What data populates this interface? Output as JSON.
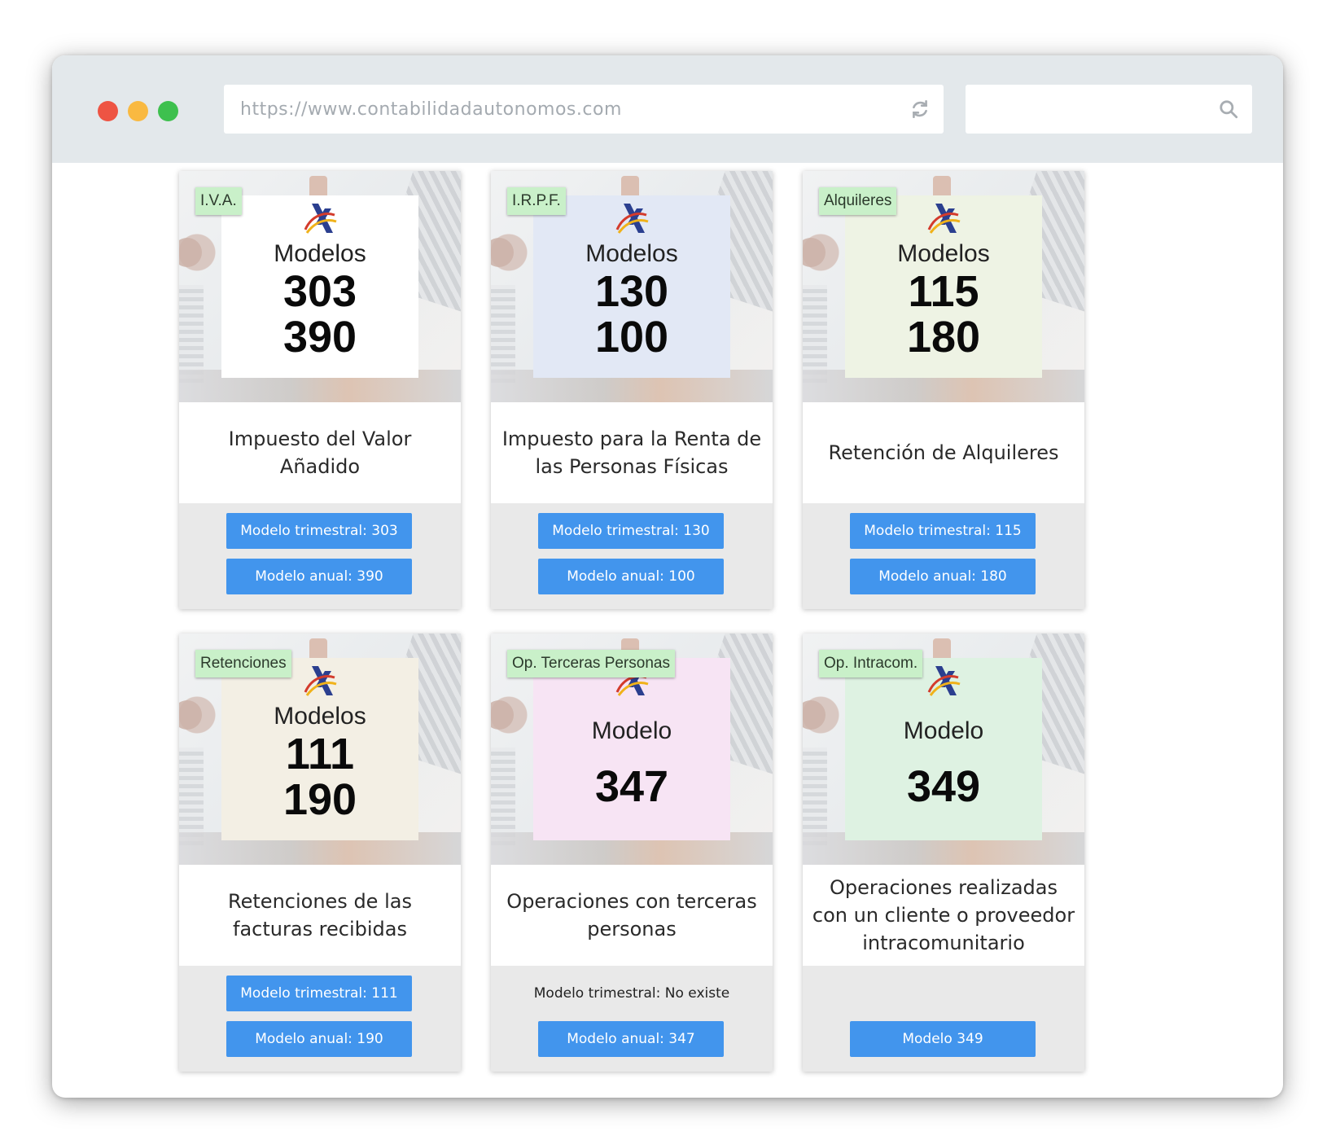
{
  "browser": {
    "url": "https://www.contabilidadautonomos.com",
    "search_value": ""
  },
  "colors": {
    "button": "#4295ed",
    "tag": "#c9f0c9",
    "poster_iva": "#ffffff",
    "poster_irpf": "#e2e8f5",
    "poster_alquileres": "#eef3e4",
    "poster_retenciones": "#f3efe4",
    "poster_terceras": "#f7e4f4",
    "poster_intracom": "#def2e2"
  },
  "cards": [
    {
      "tag": "I.V.A.",
      "poster_title": "Modelos",
      "num1": "303",
      "num2": "390",
      "description": "Impuesto del Valor Añadido",
      "btn1": "Modelo trimestral: 303",
      "btn2": "Modelo anual: 390"
    },
    {
      "tag": "I.R.P.F.",
      "poster_title": "Modelos",
      "num1": "130",
      "num2": "100",
      "description": "Impuesto para la Renta de las Personas Físicas",
      "btn1": "Modelo trimestral: 130",
      "btn2": "Modelo anual: 100"
    },
    {
      "tag": "Alquileres",
      "poster_title": "Modelos",
      "num1": "115",
      "num2": "180",
      "description": "Retención de Alquileres",
      "btn1": "Modelo trimestral: 115",
      "btn2": "Modelo anual: 180"
    },
    {
      "tag": "Retenciones",
      "poster_title": "Modelos",
      "num1": "111",
      "num2": "190",
      "description": "Retenciones de las facturas recibidas",
      "btn1": "Modelo trimestral: 111",
      "btn2": "Modelo anual: 190"
    },
    {
      "tag": "Op. Terceras Personas",
      "poster_title": "Modelo",
      "num1": "347",
      "description": "Operaciones con terceras personas",
      "note": "Modelo trimestral: No existe",
      "btn2": "Modelo anual: 347"
    },
    {
      "tag": "Op. Intracom.",
      "poster_title": "Modelo",
      "num1": "349",
      "description": "Operaciones realizadas con un cliente o proveedor intracomunitario",
      "btn2": "Modelo 349"
    }
  ]
}
